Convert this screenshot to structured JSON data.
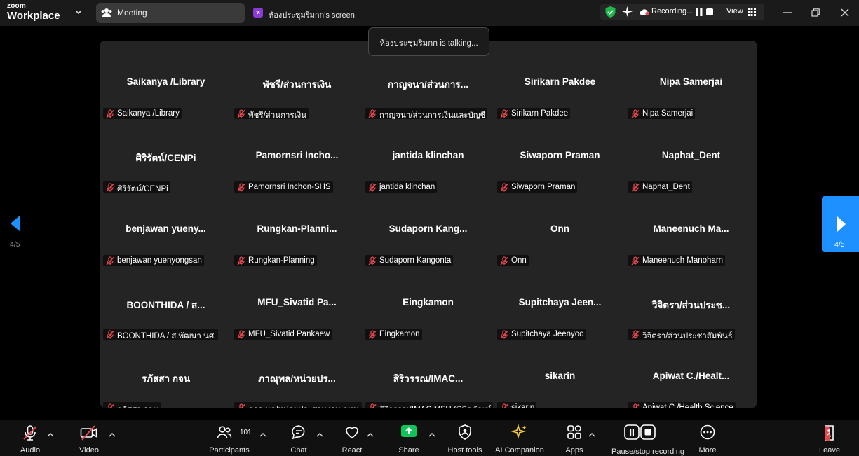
{
  "app": {
    "brand_top": "zoom",
    "brand_bottom": "Workplace"
  },
  "tabs": {
    "meeting": "Meeting",
    "screen_avatar": "ห",
    "screen": "ห้องประชุมริมกก's screen"
  },
  "status": {
    "recording": "Recording...",
    "view": "View"
  },
  "toast": "ห้องประชุมริมกก is talking...",
  "participants": [
    {
      "display": "Saikanya /Library",
      "name": "Saikanya /Library"
    },
    {
      "display": "พัชรี/ส่วนการเงิน",
      "name": "พัชรี/ส่วนการเงิน"
    },
    {
      "display": "กาญจนา/ส่วนการ...",
      "name": "กาญจนา/ส่วนการเงินและบัญชี"
    },
    {
      "display": "Sirikarn Pakdee",
      "name": "Sirikarn Pakdee"
    },
    {
      "display": "Nipa Samerjai",
      "name": "Nipa Samerjai"
    },
    {
      "display": "ศิริรัตน์/CENPi",
      "name": "ศิริรัตน์/CENPi"
    },
    {
      "display": "Pamornsri Incho...",
      "name": "Pamornsri Inchon-SHS"
    },
    {
      "display": "jantida klinchan",
      "name": "jantida klinchan"
    },
    {
      "display": "Siwaporn Praman",
      "name": "Siwaporn Praman"
    },
    {
      "display": "Naphat_Dent",
      "name": "Naphat_Dent"
    },
    {
      "display": "benjawan yueny...",
      "name": "benjawan yuenyongsan"
    },
    {
      "display": "Rungkan-Planni...",
      "name": "Rungkan-Planning"
    },
    {
      "display": "Sudaporn Kang...",
      "name": "Sudaporn Kangonta"
    },
    {
      "display": "Onn",
      "name": "Onn"
    },
    {
      "display": "Maneenuch Ma...",
      "name": "Maneenuch Manoharn"
    },
    {
      "display": "BOONTHIDA / ส...",
      "name": "BOONTHIDA / ส.พัฒนา นศ."
    },
    {
      "display": "MFU_Sivatid Pa...",
      "name": "MFU_Sivatid Pankaew"
    },
    {
      "display": "Eingkamon",
      "name": "Eingkamon"
    },
    {
      "display": "Supitchaya Jeen...",
      "name": "Supitchaya Jeenyoo"
    },
    {
      "display": "วิจิตรา/ส่วนประช...",
      "name": "วิจิตรา/ส่วนประชาสัมพันธ์"
    },
    {
      "display": "รภัสสา กจน",
      "name": "รภัสสา กจน"
    },
    {
      "display": "ภาณุพล/หน่วยปร...",
      "name": "ภาณุพล/หน่วยประสานงาน กทม."
    },
    {
      "display": "สิริวรรณ/IMAC...",
      "name": "สิริวรรณ/IMAC MFU (พิพิธภัณฑ์..."
    },
    {
      "display": "sikarin",
      "name": "sikarin"
    },
    {
      "display": "Apiwat C./Healt...",
      "name": "Apiwat C./Health Science"
    }
  ],
  "nav": {
    "left_page": "4/5",
    "right_page": "4/5"
  },
  "toolbar": {
    "audio": "Audio",
    "video": "Video",
    "participants": "Participants",
    "participants_count": "101",
    "chat": "Chat",
    "react": "React",
    "share": "Share",
    "host_tools": "Host tools",
    "ai_companion": "AI Companion",
    "apps": "Apps",
    "pause_stop": "Pause/stop recording",
    "more": "More",
    "leave": "Leave"
  },
  "colors": {
    "accent": "#1e90ff",
    "share": "#10c45a",
    "muted": "#e5484d",
    "ai": "#f5c842"
  }
}
